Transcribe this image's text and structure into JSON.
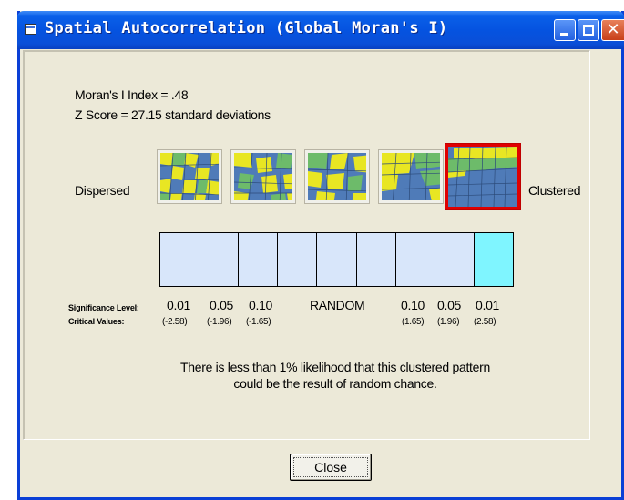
{
  "window": {
    "title": "Spatial Autocorrelation (Global Moran's I)"
  },
  "results": {
    "morans_index": "Moran's I Index = .48",
    "z_score": "Z Score = 27.15 standard deviations"
  },
  "pattern_scale": {
    "left_label": "Dispersed",
    "right_label": "Clustered",
    "selected_index": 4,
    "thumbnails": [
      "dispersed-map",
      "somewhat-dispersed-map",
      "random-map",
      "somewhat-clustered-map",
      "clustered-map"
    ]
  },
  "significance_bar": {
    "cell_count": 9,
    "active_cell_index": 8,
    "active_color": "#7ff5ff",
    "cell_color": "#d8e6fa"
  },
  "significance": {
    "level_label": "Significance Level:",
    "critical_label": "Critical Values:",
    "levels": [
      "0.01",
      "0.05",
      "0.10",
      "RANDOM",
      "0.10",
      "0.05",
      "0.01"
    ],
    "critical_values": [
      "(-2.58)",
      "(-1.96)",
      "(-1.65)",
      "(1.65)",
      "(1.96)",
      "(2.58)"
    ]
  },
  "conclusion": {
    "line1": "There is less than 1% likelihood that this clustered pattern",
    "line2": "could be the result of random chance."
  },
  "buttons": {
    "close_label": "Close"
  },
  "colors": {
    "titlebar": "#0553e0",
    "dialog_bg": "#ece9d8",
    "selection_border": "#e00000"
  }
}
